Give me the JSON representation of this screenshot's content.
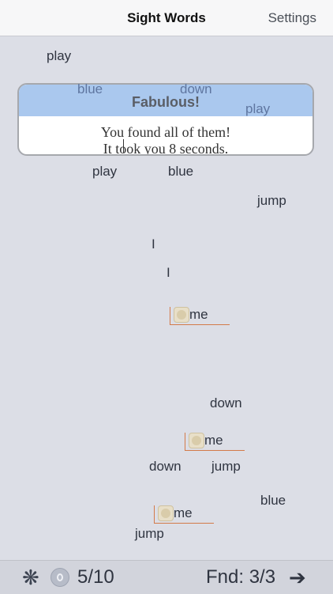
{
  "nav": {
    "title": "Sight Words",
    "settings": "Settings"
  },
  "words": [
    {
      "text": "play"
    },
    {
      "text": "play"
    },
    {
      "text": "blue"
    },
    {
      "text": "jump"
    },
    {
      "text": "I"
    },
    {
      "text": "I"
    },
    {
      "text": "down"
    },
    {
      "text": "down"
    },
    {
      "text": "jump"
    },
    {
      "text": "blue"
    },
    {
      "text": "jump"
    }
  ],
  "found_words": [
    {
      "text": "me"
    },
    {
      "text": "me"
    },
    {
      "text": "me"
    }
  ],
  "dialog": {
    "title": "Fabulous!",
    "line1": "You found all of them!",
    "line2": "It took you 8 seconds.",
    "overlay_words": [
      "blue",
      "down",
      "play"
    ]
  },
  "toolbar": {
    "flower_icon": "❋",
    "progress": "5/10",
    "found": "Fnd: 3/3",
    "arrow_icon": "➔"
  },
  "colors": {
    "background": "#dcdee6",
    "dialog_header": "#aac8ee",
    "found_underline": "#d37a49"
  }
}
